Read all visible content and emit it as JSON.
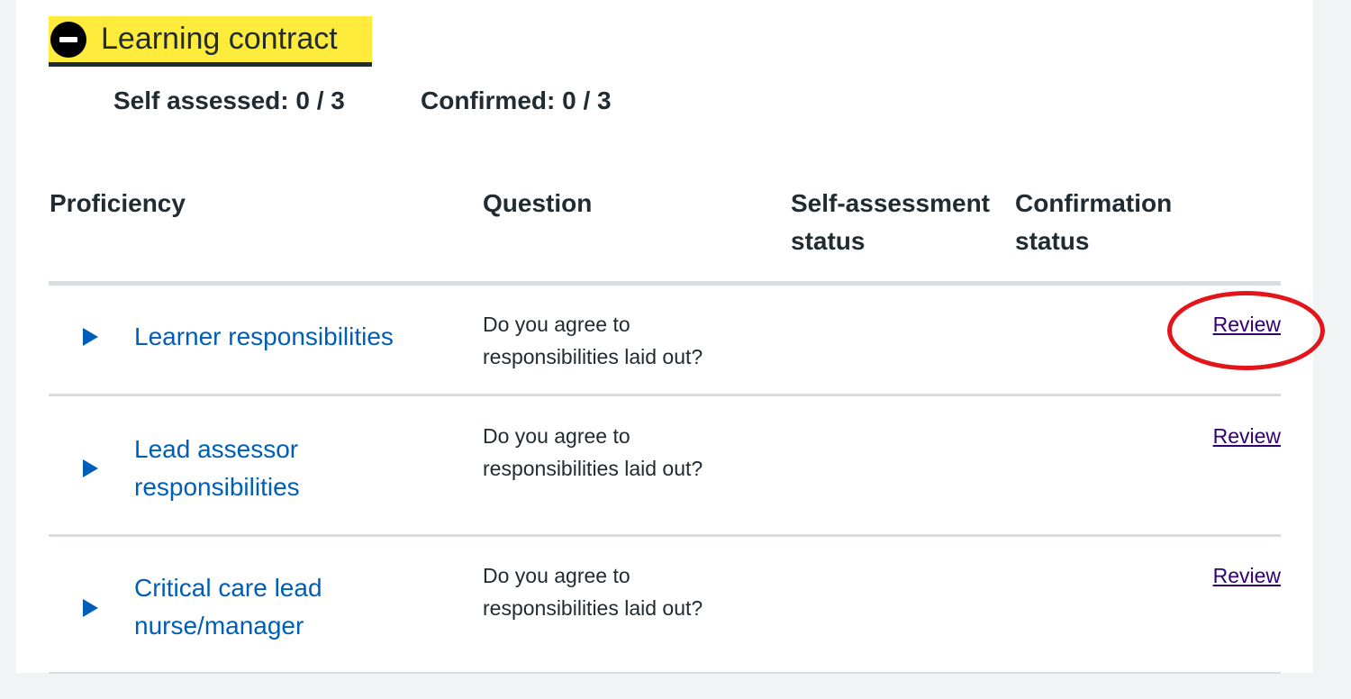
{
  "section": {
    "title": "Learning contract",
    "toggle_icon": "minus-circle-icon"
  },
  "summary": {
    "self_assessed": "Self assessed: 0 / 3",
    "confirmed": "Confirmed: 0 / 3"
  },
  "table": {
    "headers": {
      "proficiency": "Proficiency",
      "question": "Question",
      "self_assessment_status": "Self-assessment status",
      "confirmation_status": "Confirmation status"
    },
    "rows": [
      {
        "proficiency": "Learner responsibilities",
        "question": "Do you agree to responsibilities laid out?",
        "self_assessment_status": "",
        "confirmation_status": "",
        "action": "Review"
      },
      {
        "proficiency": "Lead assessor responsibilities",
        "question": "Do you agree to responsibilities laid out?",
        "self_assessment_status": "",
        "confirmation_status": "",
        "action": "Review"
      },
      {
        "proficiency": "Critical care lead nurse/manager",
        "question": "Do you agree to responsibilities laid out?",
        "self_assessment_status": "",
        "confirmation_status": "",
        "action": "Review"
      }
    ]
  },
  "colors": {
    "heading_highlight": "#ffeb3b",
    "link_blue": "#005eb8",
    "visited_link": "#330072",
    "annotation_red": "#e4141b",
    "divider": "#d8dde0",
    "page_bg": "#f0f4f5"
  }
}
